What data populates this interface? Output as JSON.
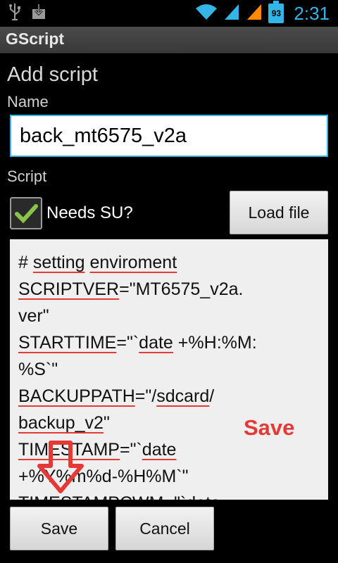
{
  "status_bar": {
    "battery_level": "93",
    "time": "2:31",
    "icons": [
      "usb-icon",
      "download-icon",
      "wifi-icon",
      "signal-icon",
      "signal-icon",
      "battery-icon"
    ]
  },
  "app": {
    "title": "GScript"
  },
  "form": {
    "heading": "Add script",
    "name_label": "Name",
    "name_value": "back_mt6575_v2a",
    "script_label": "Script",
    "needs_su_label": "Needs SU?",
    "needs_su_checked": true,
    "load_file_label": "Load file"
  },
  "script": {
    "lines": [
      "# setting enviroment",
      "SCRIPTVER=\"MT6575_v2a.",
      "ver\"",
      "STARTTIME=\"`date +%H:%M:",
      "%S`\"",
      "BACKUPPATH=\"/sdcard/",
      "backup_v2\"",
      "TIMESTAMP=\"`date",
      "+%Y%m%d-%H%M`\"",
      "TIMESTAMPCWM=\"`date"
    ]
  },
  "annotation": {
    "text": "Save",
    "color": "#e53935",
    "arrow": "down-arrow-icon"
  },
  "buttons": {
    "save_label": "Save",
    "cancel_label": "Cancel"
  },
  "colors": {
    "accent": "#33b5e5",
    "checkmark": "#8bc34a",
    "annotation": "#e53935"
  }
}
